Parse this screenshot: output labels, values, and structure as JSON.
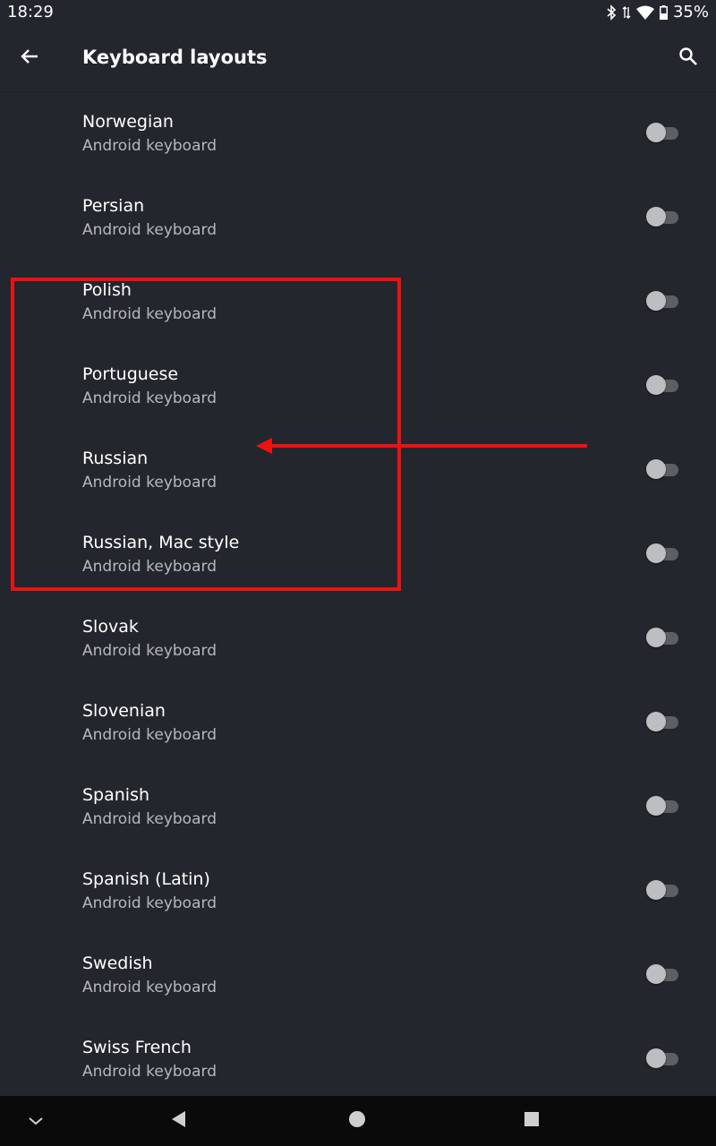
{
  "status_bar": {
    "time": "18:29",
    "battery": "35%"
  },
  "app_bar": {
    "title": "Keyboard layouts",
    "back_icon": "arrow-back-icon",
    "search_icon": "search-icon"
  },
  "layouts": [
    {
      "name": "Norwegian",
      "subtitle": "Android keyboard",
      "enabled": false
    },
    {
      "name": "Persian",
      "subtitle": "Android keyboard",
      "enabled": false
    },
    {
      "name": "Polish",
      "subtitle": "Android keyboard",
      "enabled": false
    },
    {
      "name": "Portuguese",
      "subtitle": "Android keyboard",
      "enabled": false
    },
    {
      "name": "Russian",
      "subtitle": "Android keyboard",
      "enabled": false
    },
    {
      "name": "Russian, Mac style",
      "subtitle": "Android keyboard",
      "enabled": false
    },
    {
      "name": "Slovak",
      "subtitle": "Android keyboard",
      "enabled": false
    },
    {
      "name": "Slovenian",
      "subtitle": "Android keyboard",
      "enabled": false
    },
    {
      "name": "Spanish",
      "subtitle": "Android keyboard",
      "enabled": false
    },
    {
      "name": "Spanish (Latin)",
      "subtitle": "Android keyboard",
      "enabled": false
    },
    {
      "name": "Swedish",
      "subtitle": "Android keyboard",
      "enabled": false
    },
    {
      "name": "Swiss French",
      "subtitle": "Android keyboard",
      "enabled": false
    }
  ],
  "colors": {
    "background": "#23272d",
    "annotation": "#ee1111",
    "toggle_thumb_off": "#bcbec1",
    "toggle_track_off": "#5c6065"
  },
  "nav_bar": {
    "icons": [
      "chevron-down-icon",
      "back-triangle-icon",
      "home-circle-icon",
      "recents-square-icon"
    ]
  }
}
